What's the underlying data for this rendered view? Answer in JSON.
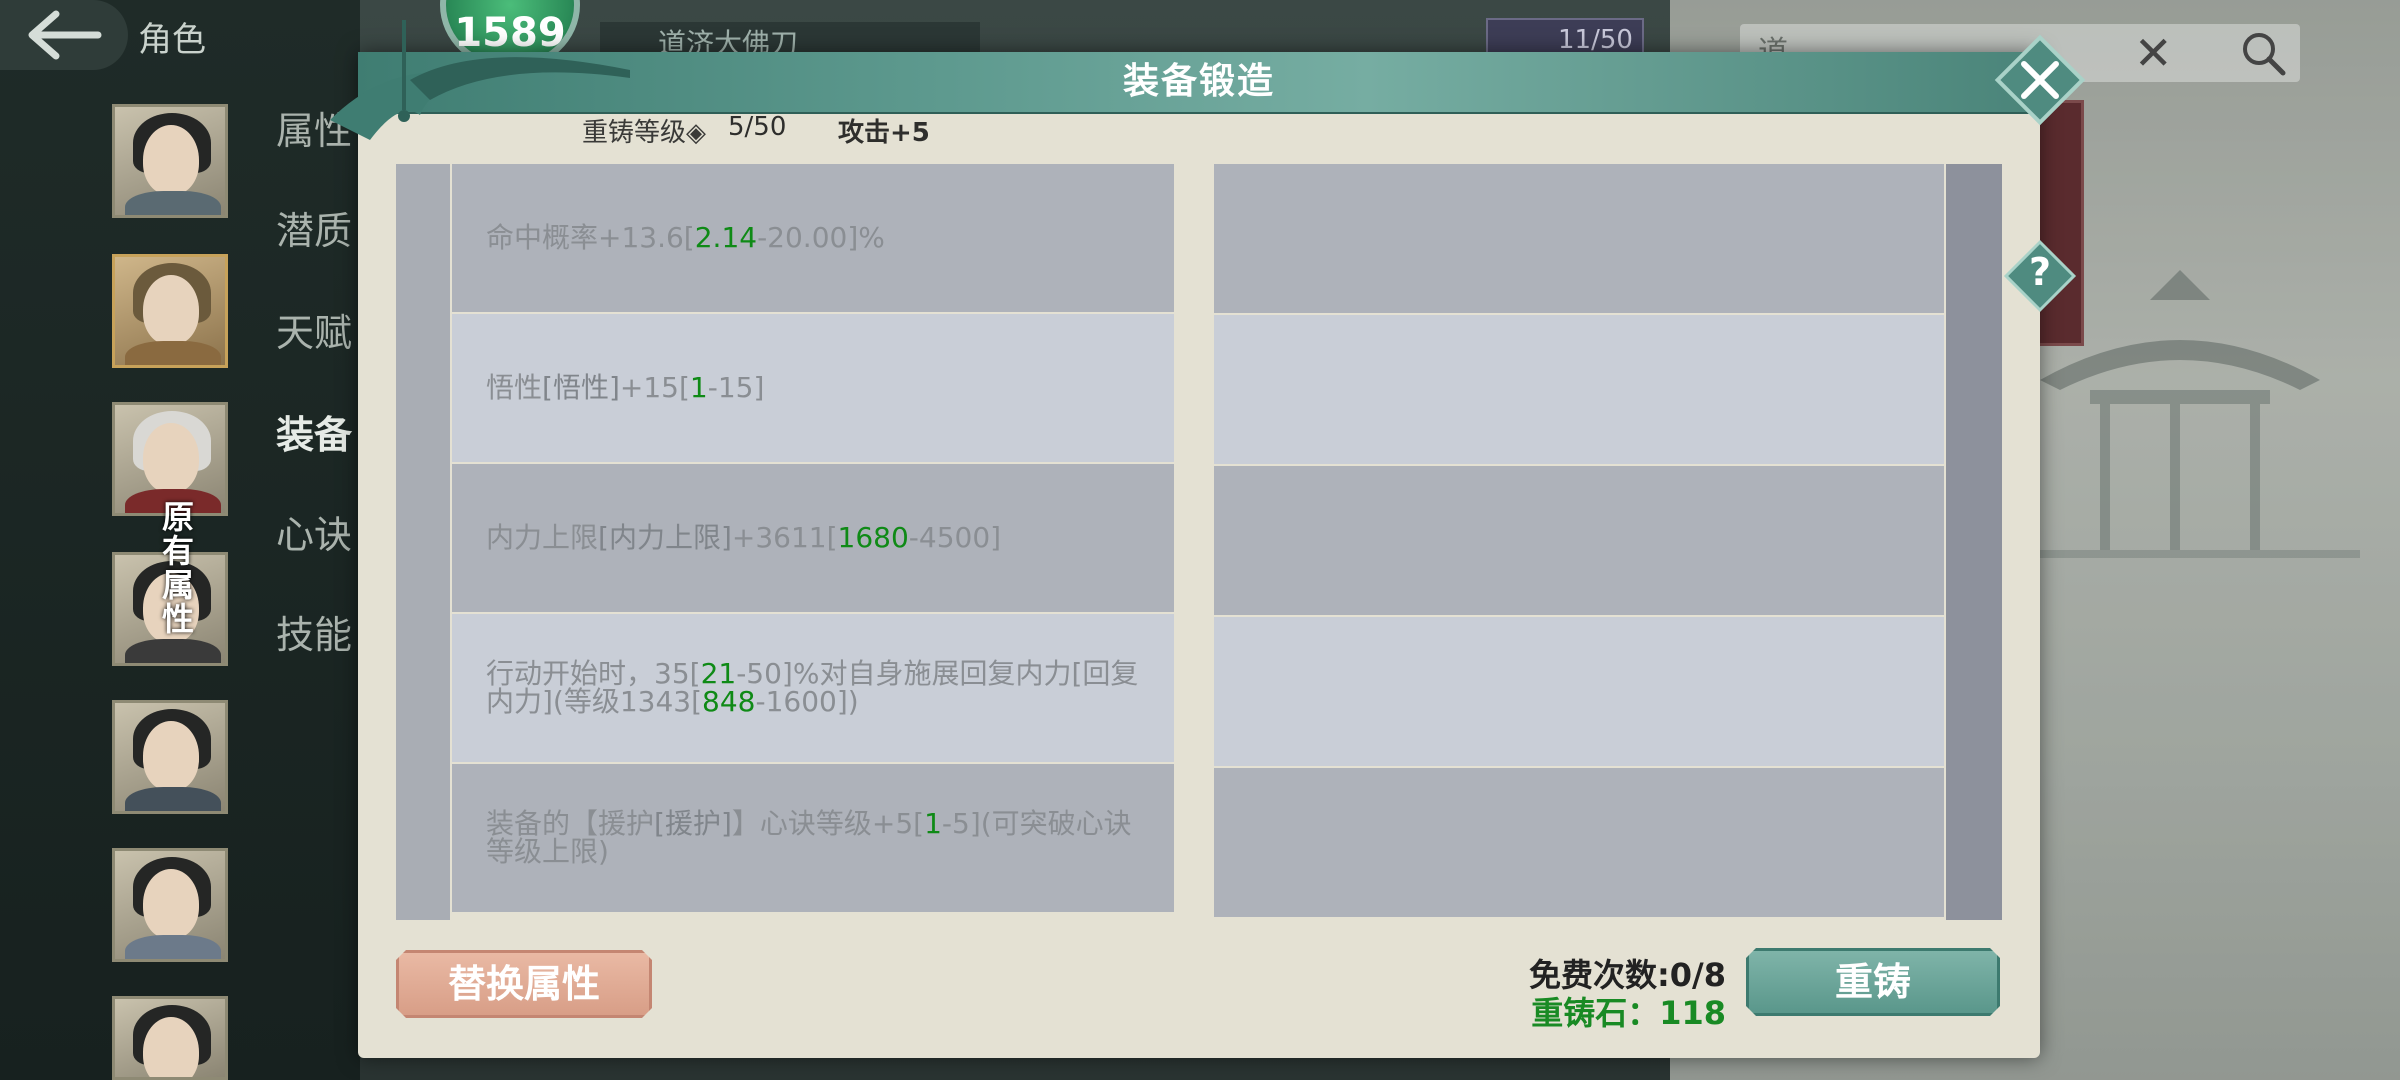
{
  "nav": {
    "back_title": "角色",
    "level_badge": "1589",
    "tabs": [
      "属性",
      "潜质",
      "天赋",
      "装备",
      "心诀",
      "技能"
    ]
  },
  "original_attr_label": "原有属性",
  "background": {
    "weapon_name": "道济大佛刀",
    "counter": "11/50",
    "search_placeholder": "道"
  },
  "dialog": {
    "title": "装备锻造",
    "reforge_level_label": "重铸等级◈",
    "reforge_level_value": "5/50",
    "attack_bonus": "攻击+5",
    "attributes": [
      {
        "segments": [
          {
            "t": "命中概率+13.6[",
            "c": "n"
          },
          {
            "t": "2.14",
            "c": "g"
          },
          {
            "t": "-20.00]%",
            "c": "n"
          }
        ]
      },
      {
        "segments": [
          {
            "t": "悟性",
            "c": "n"
          },
          {
            "t": "[悟性]",
            "c": "d"
          },
          {
            "t": "+15[",
            "c": "n"
          },
          {
            "t": "1",
            "c": "g"
          },
          {
            "t": "-15]",
            "c": "n"
          }
        ]
      },
      {
        "segments": [
          {
            "t": "内力上限",
            "c": "n"
          },
          {
            "t": "[内力上限]",
            "c": "d"
          },
          {
            "t": "+3611[",
            "c": "n"
          },
          {
            "t": "1680",
            "c": "g"
          },
          {
            "t": "-4500]",
            "c": "n"
          }
        ]
      },
      {
        "segments": [
          {
            "t": "行动开始时，35[",
            "c": "n"
          },
          {
            "t": "21",
            "c": "g"
          },
          {
            "t": "-50]%对自身施展回复内力[回复内力](等级1343[",
            "c": "n"
          },
          {
            "t": "848",
            "c": "g"
          },
          {
            "t": "-1600])",
            "c": "n"
          }
        ]
      },
      {
        "segments": [
          {
            "t": "装备的【援护",
            "c": "n"
          },
          {
            "t": "[援护]",
            "c": "d"
          },
          {
            "t": "】心诀等级+5[",
            "c": "n"
          },
          {
            "t": "1",
            "c": "g"
          },
          {
            "t": "-5](可突破心诀等级上限)",
            "c": "n"
          }
        ]
      }
    ],
    "replace_button": "替换属性",
    "free_times": "免费次数:0/8",
    "reforge_stone": "重铸石：118",
    "reforge_button": "重铸",
    "close_icon": "close-icon",
    "help_icon": "?"
  }
}
